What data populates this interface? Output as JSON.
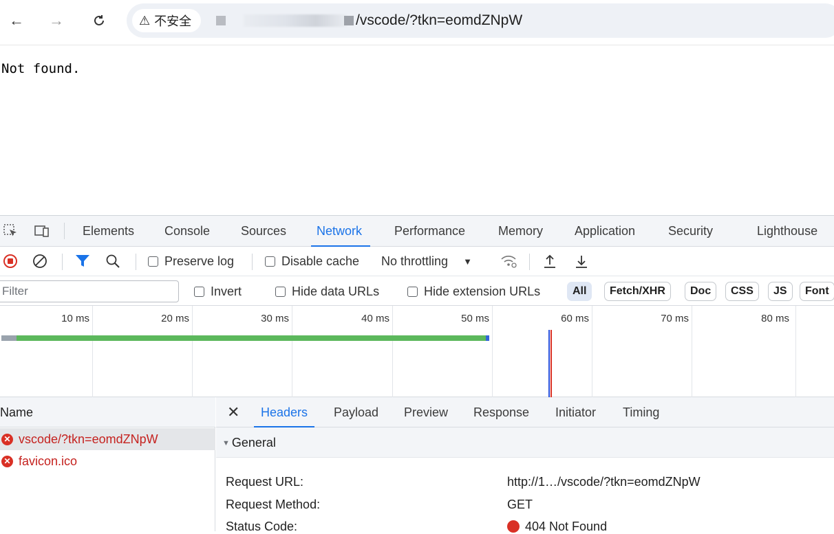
{
  "browser": {
    "security_label": "不安全",
    "url_visible": "/vscode/?tkn=eomdZNpW"
  },
  "page": {
    "message": "Not found."
  },
  "devtools": {
    "tabs": [
      "Elements",
      "Console",
      "Sources",
      "Network",
      "Performance",
      "Memory",
      "Application",
      "Security",
      "Lighthouse"
    ],
    "active_tab": "Network",
    "toolbar": {
      "preserve_log": "Preserve log",
      "disable_cache": "Disable cache",
      "throttling": "No throttling"
    },
    "filter": {
      "placeholder": "Filter",
      "invert": "Invert",
      "hide_data_urls": "Hide data URLs",
      "hide_extension_urls": "Hide extension URLs",
      "types": [
        "All",
        "Fetch/XHR",
        "Doc",
        "CSS",
        "JS",
        "Font"
      ],
      "active_type": "All"
    },
    "timeline": {
      "ticks": [
        "10 ms",
        "20 ms",
        "30 ms",
        "40 ms",
        "50 ms",
        "60 ms",
        "70 ms",
        "80 ms"
      ]
    },
    "requests": {
      "header": "Name",
      "items": [
        {
          "name": "vscode/?tkn=eomdZNpW",
          "status": "error",
          "selected": true
        },
        {
          "name": "favicon.ico",
          "status": "error",
          "selected": false
        }
      ]
    },
    "details": {
      "tabs": [
        "Headers",
        "Payload",
        "Preview",
        "Response",
        "Initiator",
        "Timing"
      ],
      "active_tab": "Headers",
      "section": "General",
      "rows": [
        {
          "label": "Request URL:",
          "value": "http://1…/vscode/?tkn=eomdZNpW"
        },
        {
          "label": "Request Method:",
          "value": "GET"
        },
        {
          "label": "Status Code:",
          "value": "404 Not Found"
        }
      ]
    }
  },
  "colors": {
    "accent": "#1a73e8",
    "error": "#d93025",
    "waterfall": "#5cb85c"
  }
}
